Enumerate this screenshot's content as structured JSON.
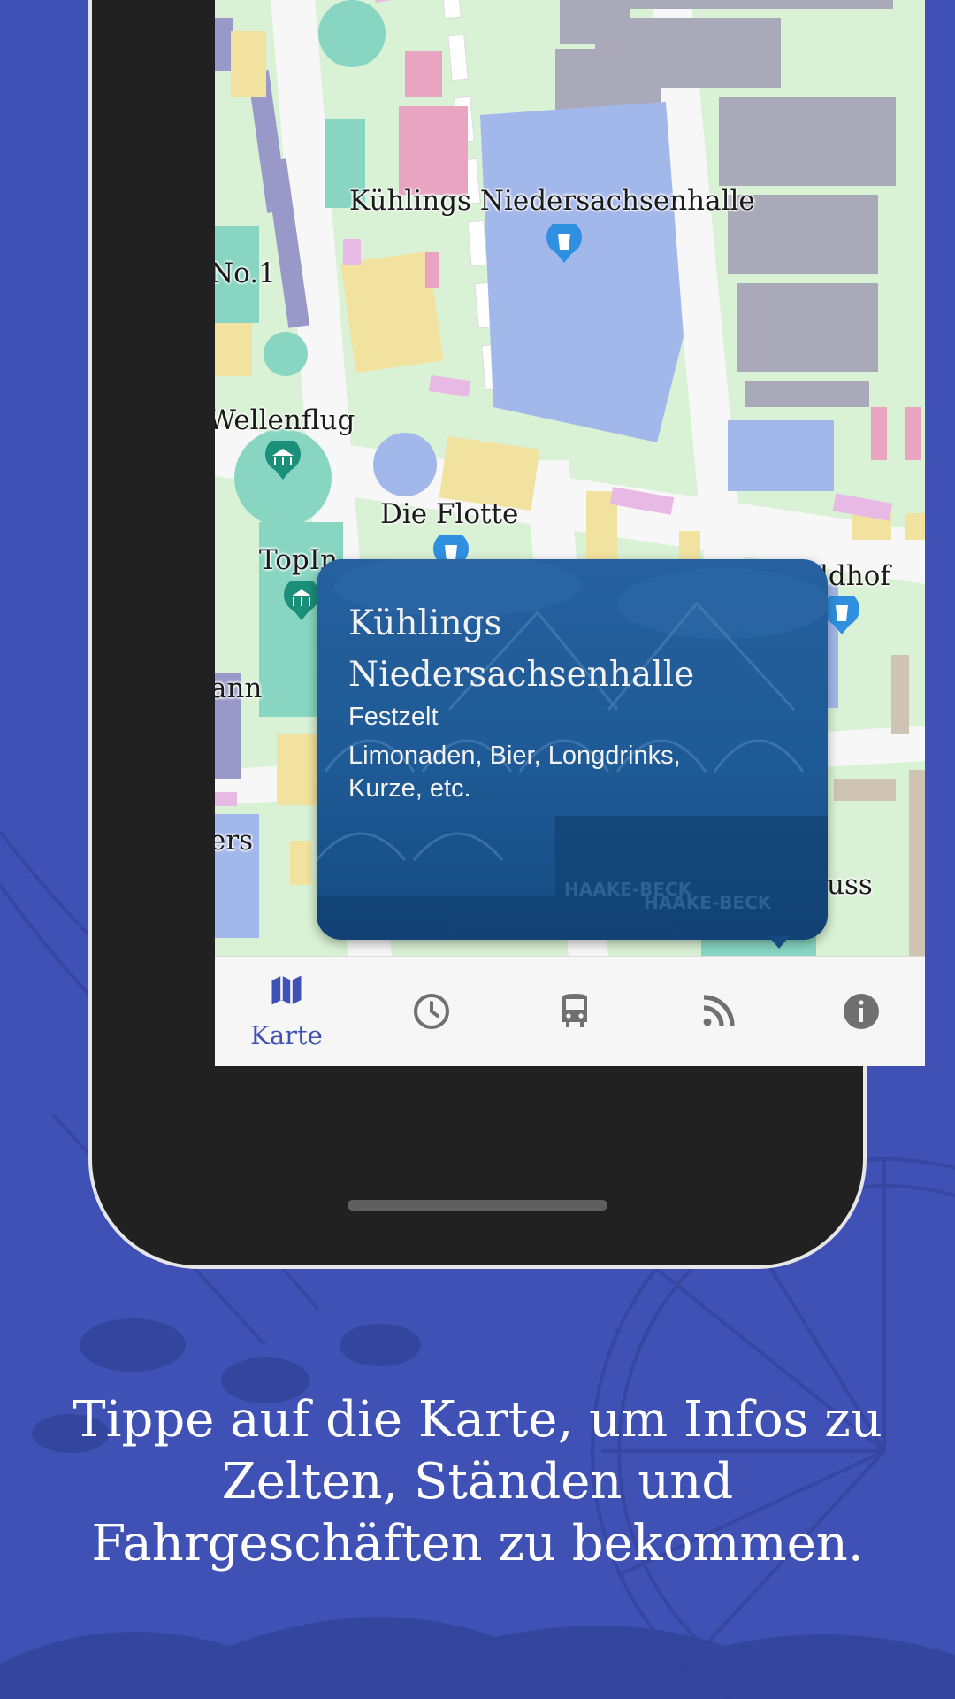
{
  "map": {
    "labels": [
      "Kühlings Niedersachsenhalle",
      "No.1",
      "Wellenflug",
      "Die Flotte",
      "TopIn",
      "ldhof",
      "ann",
      "ers",
      "uss"
    ],
    "pin_icons": [
      "drink-icon",
      "carousel-icon"
    ]
  },
  "info_card": {
    "title": "Kühlings Niedersachsenhalle",
    "category": "Festzelt",
    "description": "Limonaden, Bier, Longdrinks, Kurze, etc."
  },
  "bottom_nav": {
    "items": [
      {
        "label": "Karte",
        "icon": "map-icon",
        "active": true
      },
      {
        "label": "",
        "icon": "clock-icon",
        "active": false
      },
      {
        "label": "",
        "icon": "bus-icon",
        "active": false
      },
      {
        "label": "",
        "icon": "rss-icon",
        "active": false
      },
      {
        "label": "",
        "icon": "info-icon",
        "active": false
      }
    ]
  },
  "caption": "Tippe auf die Karte, um Infos zu Zelten, Ständen und Fahrgeschäften zu bekommen.",
  "colors": {
    "background": "#3f51b5",
    "accent": "#3f51b5",
    "card": "#1e5a95",
    "nav_inactive": "#707070"
  }
}
